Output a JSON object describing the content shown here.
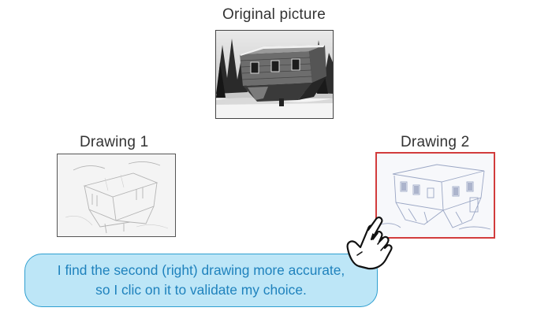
{
  "labels": {
    "original": "Original picture",
    "drawing1": "Drawing 1",
    "drawing2": "Drawing 2"
  },
  "images": {
    "original": "photo of an upside-down house among trees in snow",
    "drawing1": "faint pencil sketch of the upside-down house",
    "drawing2": "pencil sketch of the upside-down house",
    "selected": "drawing2"
  },
  "bubble": {
    "line1": "I find the second (right) drawing more accurate,",
    "line2": "so I clic on it to validate my choice."
  },
  "colors": {
    "selection_border": "#d23c3c",
    "bubble_fill": "#bde6f7",
    "bubble_border": "#2f9fd0",
    "bubble_text": "#1f82bd",
    "label_text": "#333333"
  },
  "cursor": {
    "icon": "hand-pointer-icon"
  }
}
